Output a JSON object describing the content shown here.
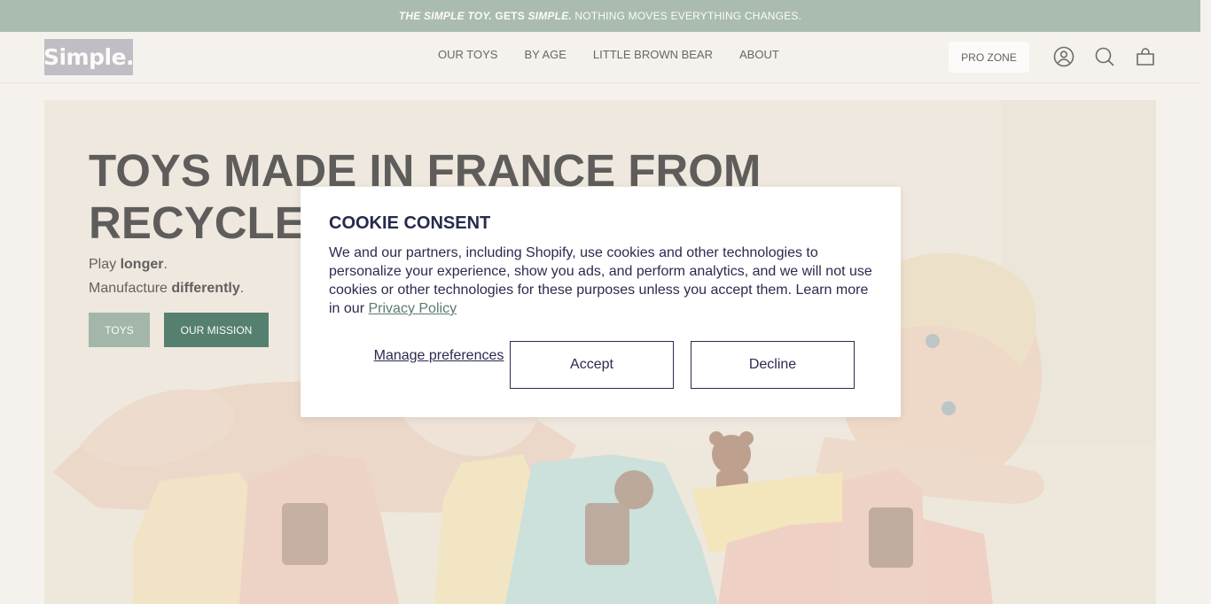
{
  "announcement": {
    "part1": "THE SIMPLE TOY.",
    "part2": "GETS",
    "part3": "SIMPLE.",
    "part4": "NOTHING MOVES EVERYTHING CHANGES."
  },
  "header": {
    "logo_text": "Simple.",
    "nav": [
      "OUR TOYS",
      "BY AGE",
      "LITTLE BROWN BEAR",
      "ABOUT"
    ],
    "pro_zone_label": "PRO ZONE",
    "icons": [
      "account-icon",
      "search-icon",
      "cart-icon"
    ]
  },
  "hero": {
    "title": "TOYS MADE IN FRANCE FROM RECYCLED",
    "line1_prefix": "Play",
    "line1_bold": "longer",
    "line1_suffix": ".",
    "line2_prefix": "Manufacture",
    "line2_bold": "differently",
    "line2_suffix": ".",
    "toys_button": "TOYS",
    "mission_button": "OUR MISSION"
  },
  "cookie": {
    "title": "COOKIE CONSENT",
    "body": "We and our partners, including Shopify, use cookies and other technologies to personalize your experience, show you ads, and perform analytics, and we will not use cookies or other technologies for these purposes unless you accept them. Learn more in our",
    "link": "Privacy Policy",
    "manage": "Manage preferences",
    "accept": "Accept",
    "decline": "Decline"
  },
  "colors": {
    "announcement_bg": "#88a596",
    "page_bg": "#f5f1ec",
    "mission_button": "#114f3b",
    "toys_button": "#7f9d8e",
    "modal_text": "#2a2b4f"
  }
}
